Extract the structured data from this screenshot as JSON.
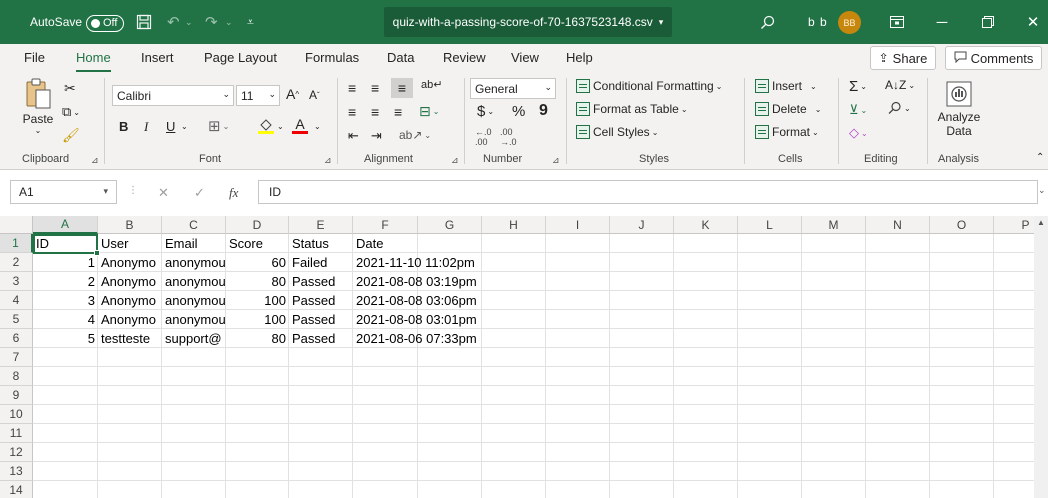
{
  "titlebar": {
    "autosave_label": "AutoSave",
    "autosave_state": "Off",
    "filename": "quiz-with-a-passing-score-of-70-1637523148.csv",
    "user_name": "b b",
    "user_initials": "BB"
  },
  "tabs": [
    "File",
    "Home",
    "Insert",
    "Page Layout",
    "Formulas",
    "Data",
    "Review",
    "View",
    "Help"
  ],
  "active_tab": "Home",
  "share_label": "Share",
  "comments_label": "Comments",
  "ribbon": {
    "clipboard": {
      "paste": "Paste",
      "label": "Clipboard"
    },
    "font": {
      "name": "Calibri",
      "size": "11",
      "label": "Font",
      "bold": "B",
      "italic": "I",
      "underline": "U"
    },
    "alignment": {
      "label": "Alignment"
    },
    "number": {
      "format": "General",
      "currency": "$",
      "percent": "%",
      "comma": "9",
      "label": "Number"
    },
    "styles": {
      "conditional": "Conditional Formatting",
      "format_table": "Format as Table",
      "cell_styles": "Cell Styles",
      "label": "Styles"
    },
    "cells": {
      "insert": "Insert",
      "delete": "Delete",
      "format": "Format",
      "label": "Cells"
    },
    "editing": {
      "label": "Editing"
    },
    "analysis": {
      "analyze_line1": "Analyze",
      "analyze_line2": "Data",
      "label": "Analysis"
    }
  },
  "formula_bar": {
    "name_box": "A1",
    "fx": "fx",
    "value": "ID"
  },
  "columns": [
    "A",
    "B",
    "C",
    "D",
    "E",
    "F",
    "G",
    "H",
    "I",
    "J",
    "K",
    "L",
    "M",
    "N",
    "O",
    "P"
  ],
  "rows": [
    "1",
    "2",
    "3",
    "4",
    "5",
    "6",
    "7",
    "8",
    "9",
    "10",
    "11",
    "12",
    "13",
    "14"
  ],
  "sheet": {
    "header": [
      "ID",
      "User",
      "Email",
      "Score",
      "Status",
      "Date"
    ],
    "data": [
      [
        "1",
        "Anonymo",
        "anonymou",
        "60",
        "Failed",
        "2021-11-10 11:02pm"
      ],
      [
        "2",
        "Anonymo",
        "anonymou",
        "80",
        "Passed",
        "2021-08-08 03:19pm"
      ],
      [
        "3",
        "Anonymo",
        "anonymou",
        "100",
        "Passed",
        "2021-08-08 03:06pm"
      ],
      [
        "4",
        "Anonymo",
        "anonymou",
        "100",
        "Passed",
        "2021-08-08 03:01pm"
      ],
      [
        "5",
        "testteste",
        "support@",
        "80",
        "Passed",
        "2021-08-06 07:33pm"
      ]
    ]
  },
  "colors": {
    "accent": "#217346"
  }
}
